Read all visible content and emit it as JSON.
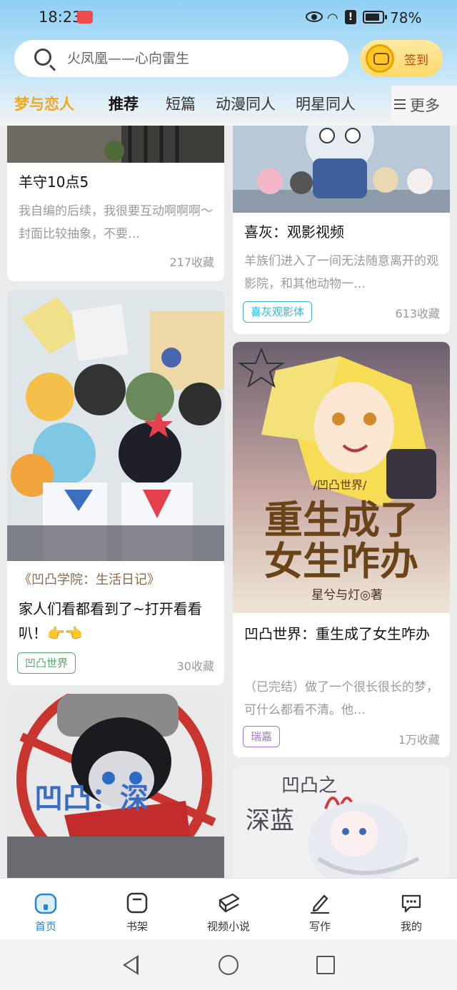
{
  "status_bar": {
    "time": "18:23",
    "battery": "78%"
  },
  "search": {
    "placeholder": "火凤凰——心向雷生"
  },
  "checkin": {
    "label": "签到"
  },
  "tabs": [
    {
      "label": "梦与恋人"
    },
    {
      "label": "推荐"
    },
    {
      "label": "短篇"
    },
    {
      "label": "动漫同人"
    },
    {
      "label": "明星同人"
    }
  ],
  "more": {
    "label": "更多"
  },
  "cards": {
    "c1": {
      "title": "羊守10点5",
      "desc": "我自编的后续，我很要互动啊啊啊～封面比较抽象，不要…",
      "count": "217收藏"
    },
    "c2": {
      "title": "喜灰：观影视频",
      "desc": "羊族们进入了一间无法随意离开的观影院，和其他动物一…",
      "tag": "喜灰观影体",
      "count": "613收藏"
    },
    "c3": {
      "quote": "《凹凸学院：生活日记》",
      "title": "家人们看都看到了~打开看看叭！👉👈",
      "tag": "凹凸世界",
      "count": "30收藏"
    },
    "c4": {
      "cover_series": "/凹凸世界/",
      "cover_title1": "重生成了",
      "cover_title2": "女生咋办",
      "cover_author": "星兮与灯◎著",
      "title": "凹凸世界：重生成了女生咋办",
      "desc": "（已完结）做了一个很长很长的梦，可什么都看不清。他…",
      "tag": "瑞嘉",
      "count": "1万收藏"
    },
    "c5": {
      "cover_text": "凹凸：深"
    },
    "c6": {
      "cover_text1": "凹凸之",
      "cover_text2": "深蓝"
    }
  },
  "bottom_nav": [
    {
      "label": "首页",
      "icon": "home-icon"
    },
    {
      "label": "书架",
      "icon": "bookshelf-icon"
    },
    {
      "label": "视频小说",
      "icon": "video-book-icon"
    },
    {
      "label": "写作",
      "icon": "pen-icon"
    },
    {
      "label": "我的",
      "icon": "chat-icon"
    }
  ],
  "colors": {
    "accent_tab": "#f2a81d",
    "nav_active": "#2287d9",
    "tag_blue": "#38b3d6",
    "tag_green": "#55a86a",
    "tag_purple": "#a676d2"
  }
}
